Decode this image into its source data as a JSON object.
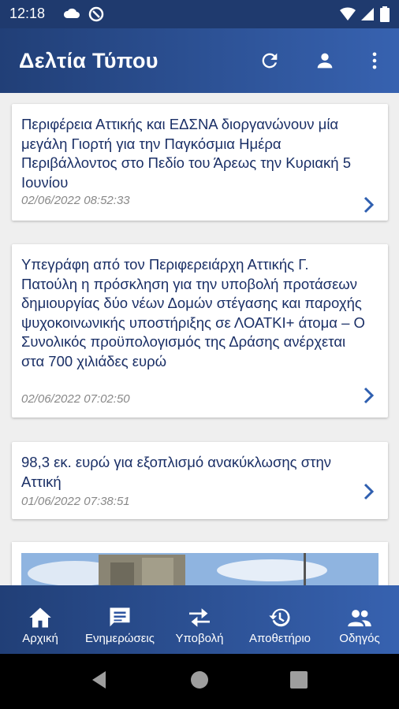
{
  "status_bar": {
    "time": "12:18",
    "icons": [
      "cloud-icon",
      "sync-circle-icon",
      "wifi-icon",
      "signal-icon",
      "battery-icon"
    ]
  },
  "app_bar": {
    "title": "Δελτία Τύπου",
    "actions": [
      "refresh-icon",
      "account-icon",
      "more-vert-icon"
    ]
  },
  "press_releases": [
    {
      "title": "Περιφέρεια Αττικής και ΕΔΣΝΑ διοργανώνουν μία μεγάλη Γιορτή για την Παγκόσμια Ημέρα Περιβάλλοντος στο Πεδίο του Άρεως την Κυριακή 5 Ιουνίου",
      "date": "02/06/2022 08:52:33"
    },
    {
      "title": "Υπεγράφη από τον Περιφερειάρχη Αττικής Γ. Πατούλη η πρόσκληση για την υποβολή προτάσεων δημιουργίας δύο νέων Δομών στέγασης και παροχής ψυχοκοινωνικής υποστήριξης σε ΛΟΑΤΚΙ+ άτομα – Ο Συνολικός προϋπολογισμός της Δράσης ανέρχεται στα 700 χιλιάδες ευρώ",
      "date": "02/06/2022 07:02:50"
    },
    {
      "title": "98,3 εκ. ευρώ για εξοπλισμό ανακύκλωσης στην Αττική",
      "date": "01/06/2022 07:38:51"
    }
  ],
  "bottom_nav": [
    {
      "label": "Αρχική",
      "icon": "home-icon"
    },
    {
      "label": "Ενημερώσεις",
      "icon": "message-icon"
    },
    {
      "label": "Υποβολή",
      "icon": "compare-arrows-icon"
    },
    {
      "label": "Αποθετήριο",
      "icon": "history-icon"
    },
    {
      "label": "Οδηγός",
      "icon": "people-icon"
    }
  ],
  "colors": {
    "app_bar_start": "#213f77",
    "app_bar_end": "#3762b0",
    "title_text": "#1a2f66",
    "chevron": "#2f5fb0",
    "date_text": "#888888",
    "background": "#efefef"
  }
}
